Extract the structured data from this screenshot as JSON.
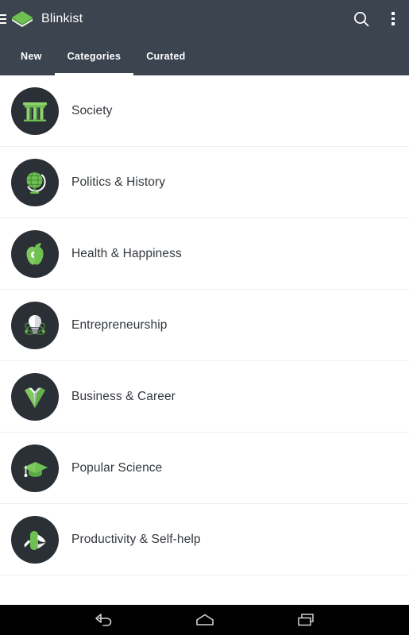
{
  "appbar": {
    "menu_icon": "hamburger-menu-icon",
    "logo_icon": "blinkist-book-logo",
    "title": "Blinkist",
    "search_icon": "search-icon",
    "overflow_icon": "overflow-menu-icon"
  },
  "tabs": [
    {
      "label": "New",
      "active": false
    },
    {
      "label": "Categories",
      "active": true
    },
    {
      "label": "Curated",
      "active": false
    }
  ],
  "categories": [
    {
      "label": "Society",
      "icon": "temple-columns-icon"
    },
    {
      "label": "Politics & History",
      "icon": "globe-icon"
    },
    {
      "label": "Health & Happiness",
      "icon": "apple-icon"
    },
    {
      "label": "Entrepreneurship",
      "icon": "lightbulb-atom-icon"
    },
    {
      "label": "Business & Career",
      "icon": "suit-tie-icon"
    },
    {
      "label": "Popular Science",
      "icon": "graduation-cap-icon"
    },
    {
      "label": "Productivity & Self-help",
      "icon": "swiss-army-knife-icon"
    }
  ],
  "navbar": {
    "back_label": "back-icon",
    "home_label": "home-icon",
    "recents_label": "recent-apps-icon"
  },
  "colors": {
    "appbar_bg": "#3c4450",
    "accent_green": "#6ec053",
    "avatar_bg": "#2b3036",
    "label_text": "#33383d",
    "divider": "#eceef0",
    "navbar_bg": "#000000"
  }
}
